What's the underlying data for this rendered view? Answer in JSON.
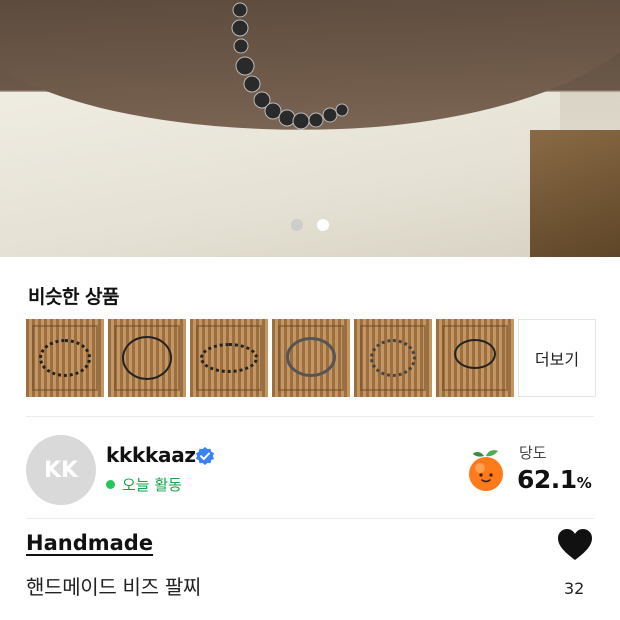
{
  "carousel": {
    "page_count": 2,
    "active_index": 1
  },
  "similar": {
    "title": "비슷한 상품",
    "thumbnails": [
      "bracelet-1",
      "bracelet-2",
      "bracelet-3",
      "bracelet-4",
      "bracelet-5",
      "bracelet-6"
    ],
    "more_label": "더보기"
  },
  "seller": {
    "avatar_initials": "KK",
    "name": "kkkkaaz",
    "verified_icon": "verified-badge-icon",
    "activity": "오늘 활동",
    "temperature_label": "당도",
    "temperature_value": "62.1",
    "temperature_unit": "%",
    "temperature_icon": "peach-icon"
  },
  "product": {
    "tag": "Handmade",
    "title": "핸드메이드 비즈 팔찌",
    "like_count": "32",
    "like_icon": "heart-icon"
  },
  "colors": {
    "accent_green": "#22c55e",
    "verified_blue": "#3b82f6"
  }
}
